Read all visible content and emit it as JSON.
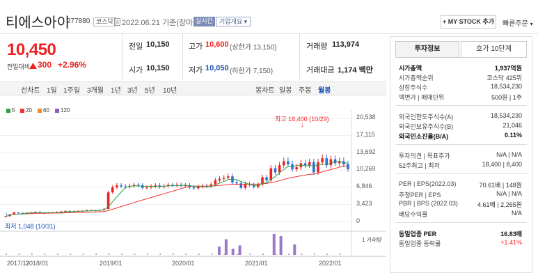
{
  "header": {
    "title": "티에스아이",
    "code": "277880",
    "market": "코스닥",
    "date": "2022.06.21 기준(장마감)",
    "realtime": "실시간",
    "corp_info": "기업개요",
    "mystock": "+ MY STOCK 추가",
    "quick": "빠른주문"
  },
  "price": {
    "current": "10,450",
    "change_label": "전일대비",
    "change": "300",
    "change_pct": "+2.96%"
  },
  "stats": {
    "prev_label": "전일",
    "prev": "10,150",
    "high_label": "고가",
    "high": "10,600",
    "upper": "(상한가 13,150)",
    "volume_label": "거래량",
    "volume": "113,974",
    "open_label": "시가",
    "open": "10,150",
    "low_label": "저가",
    "low": "10,050",
    "lower": "(하한가 7,150)",
    "amount_label": "거래대금",
    "amount": "1,174 백만"
  },
  "period": {
    "line_label": "선차트",
    "line_opts": [
      "1일",
      "1주일",
      "3개월",
      "1년",
      "3년",
      "5년",
      "10년"
    ],
    "candle_label": "봉차트",
    "candle_opts": [
      "일봉",
      "주봉",
      "월봉"
    ],
    "active_candle": "월봉"
  },
  "chart_legend": [
    "5",
    "20",
    "60",
    "120"
  ],
  "colors": {
    "ma5": "#2ea043",
    "ma20": "#e33",
    "ma60": "#f08a24",
    "ma120": "#8a5cc2",
    "up": "#e22",
    "down": "#2a6fd6",
    "volume": "#9a79c7"
  },
  "chart_data": {
    "type": "candlestick",
    "y_ticks": [
      "20,538",
      "17,115",
      "13,692",
      "10,269",
      "6,846",
      "3,423",
      "0"
    ],
    "x_ticks": [
      "2017/12",
      "2018/01",
      "2019/01",
      "2020/01",
      "2021/01",
      "2022/01"
    ],
    "high_annotation": "최고 18,400 (10/29)",
    "low_annotation": "최저 1,048 (10/31)",
    "volume_label": "1 거래량",
    "ylim": [
      0,
      20538
    ],
    "close_series": [
      1048,
      1400,
      1800,
      1700,
      1600,
      1750,
      1800,
      1900,
      1700,
      1650,
      1750,
      1800,
      1900,
      2000,
      2100,
      1950,
      2050,
      2100,
      2100,
      2250,
      2150,
      2200,
      2300,
      2500,
      5800,
      6800,
      7200,
      7000,
      6900,
      7100,
      7300,
      7200,
      6700,
      6800,
      7000,
      7200,
      6900,
      7100,
      7300,
      7200,
      7300,
      7100,
      7200,
      6800,
      6600,
      6900,
      7100,
      7000,
      7400,
      8200,
      8500,
      8700,
      9000,
      7800,
      7600,
      6700,
      7500,
      7300,
      6900,
      7400,
      8800,
      8200,
      10600,
      9800,
      11200,
      12000,
      11400,
      10400,
      10800,
      11600,
      11200,
      11800,
      9800,
      11800,
      12600,
      11200,
      12400,
      11600,
      12000,
      11400,
      10450
    ],
    "volume_spikes": [
      {
        "x": 0.62,
        "v": 0.4
      },
      {
        "x": 0.64,
        "v": 0.75
      },
      {
        "x": 0.66,
        "v": 0.3
      },
      {
        "x": 0.68,
        "v": 0.45
      },
      {
        "x": 0.78,
        "v": 1.0
      },
      {
        "x": 0.8,
        "v": 0.9
      },
      {
        "x": 0.84,
        "v": 0.5
      }
    ]
  },
  "invest": {
    "tab1": "투자정보",
    "tab2": "호가 10단계",
    "rows": [
      {
        "k": "시가총액",
        "v": "1,937억원",
        "bold": true
      },
      {
        "k": "시가총액순위",
        "v": "코스닥 425위"
      },
      {
        "k": "상장주식수",
        "v": "18,534,230"
      },
      {
        "k": "액면가 | 매매단위",
        "v": "500원 | 1주"
      },
      {
        "k": "외국인한도주식수(A)",
        "v": "18,534,230"
      },
      {
        "k": "외국인보유주식수(B)",
        "v": "21,046"
      },
      {
        "k": "외국인소진율(B/A)",
        "v": "0.11%",
        "bold": true
      },
      {
        "k": "투자의견 | 목표주가",
        "v": "N/A | N/A"
      },
      {
        "k": "52주최고 | 최저",
        "v": "18,400 | 8,400"
      },
      {
        "k": "PER | EPS(2022.03)",
        "v": "70.61배 | 148원"
      },
      {
        "k": "추정PER | EPS",
        "v": "N/A | N/A"
      },
      {
        "k": "PBR | BPS (2022.03)",
        "v": "4.61배 | 2,265원"
      },
      {
        "k": "배당수익률",
        "v": "N/A"
      },
      {
        "k": "동일업종 PER",
        "v": "16.83배",
        "bold": true
      },
      {
        "k": "동일업종 등락률",
        "v": "+1.41%",
        "red": true
      }
    ]
  }
}
